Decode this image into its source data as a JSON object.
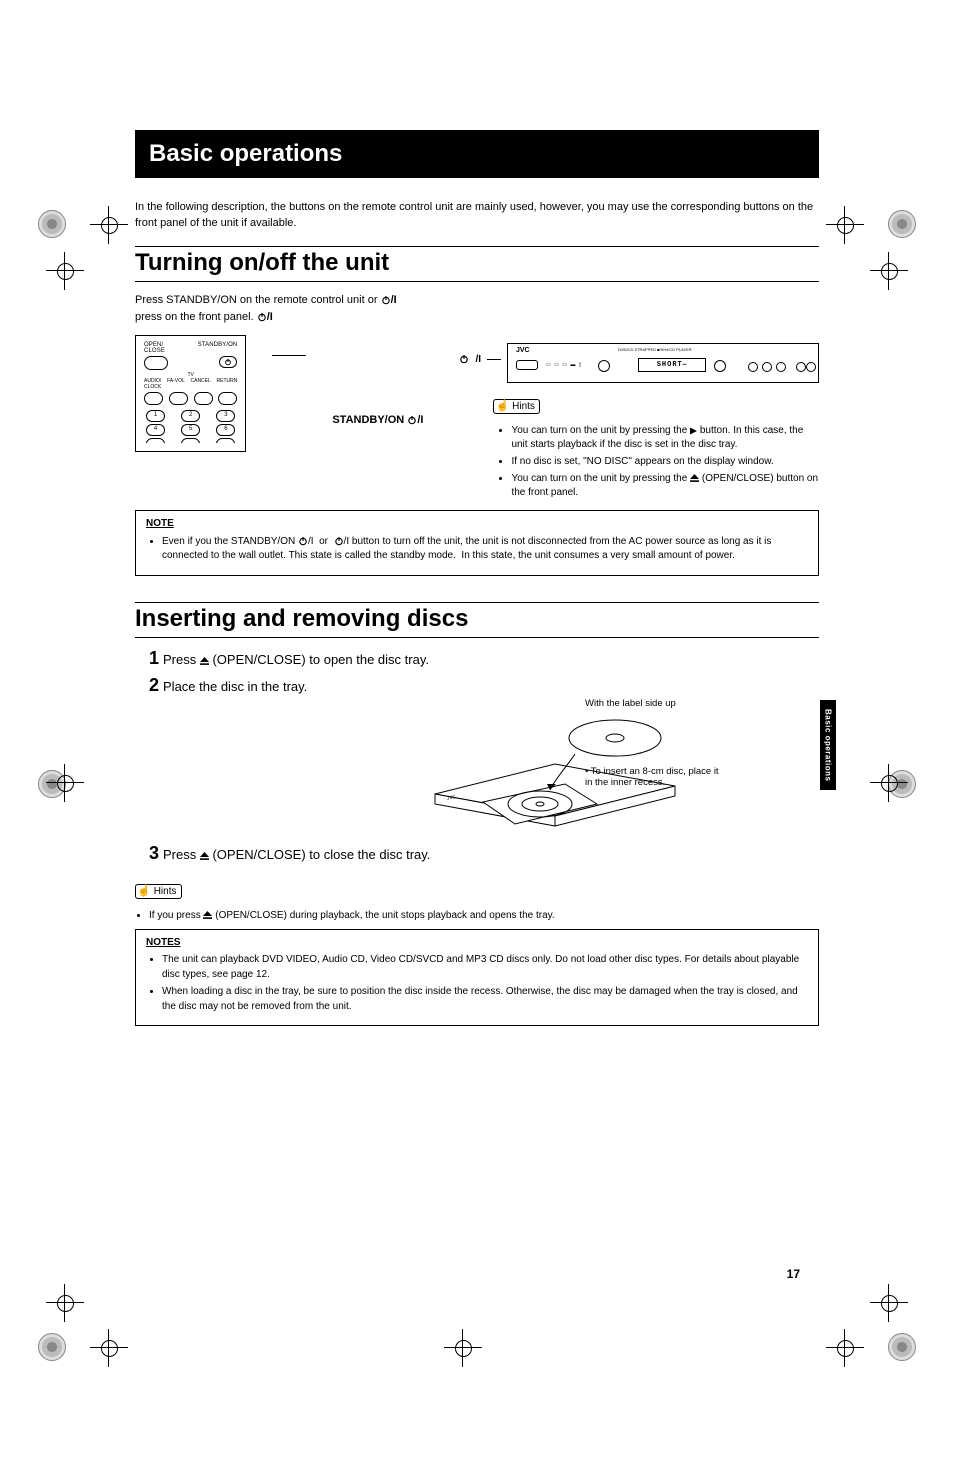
{
  "header": "Basic operations",
  "intro": "In the following description, the buttons on the remote control unit are mainly used, however, you may use the corresponding buttons on the front panel of the unit if available.",
  "section1_title": "Turning on/off the unit",
  "section1_instr_a": "Press STANDBY/ON  on the remote control unit or",
  "section1_instr_b": "press  on the front panel.",
  "label_standby_on": "STANDBY/ON",
  "remote_labels": {
    "open_close": "OPEN/\nCLOSE",
    "standby_on": "STANDBY/ON",
    "tv": "TV",
    "audio": "AUDIO/\nCLOCK",
    "fa_vol": "FA-VOL",
    "cancel": "CANCEL",
    "return": "RETURN"
  },
  "front_panel": {
    "brand": "JVC",
    "subtitle": "DVD/CD  STRAPPED ■/KHz/CD PLAYER",
    "display_text": "SHORT⎯"
  },
  "hints_label": "Hints",
  "hints1": [
    "You can turn on the unit by pressing the ▶ button. In this case, the unit starts playback if the disc is set in the disc tray.",
    "If no disc is set, \"NO DISC\" appears on the display window.",
    "You can turn on the unit by pressing the ⏏ (OPEN/CLOSE) button on the front panel."
  ],
  "note1_title": "NOTE",
  "note1_body": "Even if you the STANDBY/ON   or   button to turn off the unit, the unit is not disconnected from the AC power source as long as it is connected to the wall outlet. This state is called the standby mode.  In this state, the unit consumes a very small amount of power.",
  "section2_title": "Inserting and removing discs",
  "step1": "Press ⏏ (OPEN/CLOSE) to open the disc tray.",
  "step2": "Place the disc in the tray.",
  "fig_caption_top": "With the label side up",
  "fig_caption_side": "• To insert an 8-cm disc, place it in the inner recess.",
  "step3": "Press ⏏ (OPEN/CLOSE) to close the disc tray.",
  "hints2": [
    "If you press ⏏ (OPEN/CLOSE) during playback, the unit stops playback and opens the tray."
  ],
  "notes2_title": "NOTES",
  "notes2_items": [
    "The unit can playback DVD VIDEO, Audio CD, Video CD/SVCD and MP3 CD discs only.  Do not load other disc types. For details about playable disc types, see page 12.",
    "When loading a disc in the tray, be sure to position the disc inside the recess. Otherwise, the disc may be damaged when the tray is closed, and the disc may not be removed from the unit."
  ],
  "side_tab": "Basic operations",
  "page_number": "17"
}
